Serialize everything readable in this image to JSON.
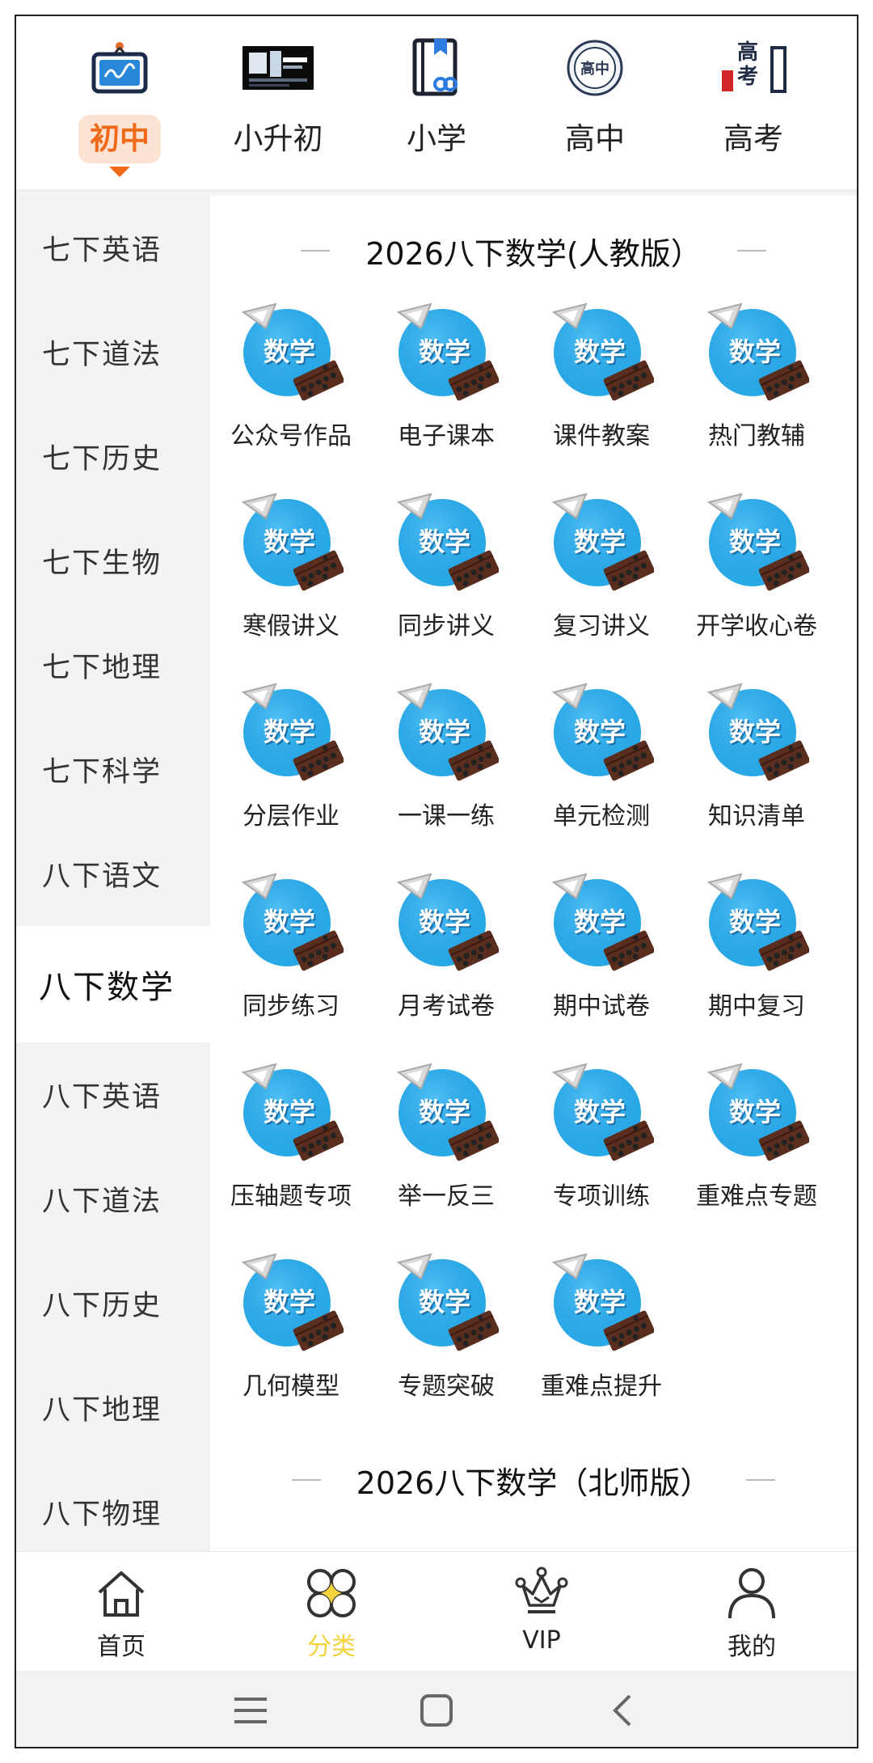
{
  "level_tabs": [
    {
      "label": "初中",
      "icon": "tv-icon",
      "active": true
    },
    {
      "label": "小升初",
      "icon": "banner-thumbnail"
    },
    {
      "label": "小学",
      "icon": "book-link-icon"
    },
    {
      "label": "高中",
      "icon": "gaozhong-badge-icon",
      "badge_text": "高中"
    },
    {
      "label": "高考",
      "icon": "gaokao-logo-icon",
      "badge_text": "高考"
    }
  ],
  "sidebar": {
    "items": [
      {
        "label": "七下英语"
      },
      {
        "label": "七下道法"
      },
      {
        "label": "七下历史"
      },
      {
        "label": "七下生物"
      },
      {
        "label": "七下地理"
      },
      {
        "label": "七下科学"
      },
      {
        "label": "八下语文"
      },
      {
        "label": "八下数学",
        "active": true
      },
      {
        "label": "八下英语"
      },
      {
        "label": "八下道法"
      },
      {
        "label": "八下历史"
      },
      {
        "label": "八下地理"
      },
      {
        "label": "八下物理"
      }
    ]
  },
  "content": {
    "section1_title": "2026八下数学(人教版）",
    "icon_text": "数学",
    "items": [
      "公众号作品",
      "电子课本",
      "课件教案",
      "热门教辅",
      "寒假讲义",
      "同步讲义",
      "复习讲义",
      "开学收心卷",
      "分层作业",
      "一课一练",
      "单元检测",
      "知识清单",
      "同步练习",
      "月考试卷",
      "期中试卷",
      "期中复习",
      "压轴题专项",
      "举一反三",
      "专项训练",
      "重难点专题",
      "几何模型",
      "专题突破",
      "重难点提升"
    ],
    "section2_title": "2026八下数学（北师版）"
  },
  "bottom_nav": [
    {
      "label": "首页",
      "icon": "home-icon"
    },
    {
      "label": "分类",
      "icon": "category-icon",
      "active": true
    },
    {
      "label": "VIP",
      "icon": "crown-icon"
    },
    {
      "label": "我的",
      "icon": "profile-icon"
    }
  ],
  "colors": {
    "accent": "#f06a1a",
    "active_tab_bg": "#fde3d3",
    "nav_active": "#f2d33c",
    "math_icon_blue": "#29a9e8"
  }
}
